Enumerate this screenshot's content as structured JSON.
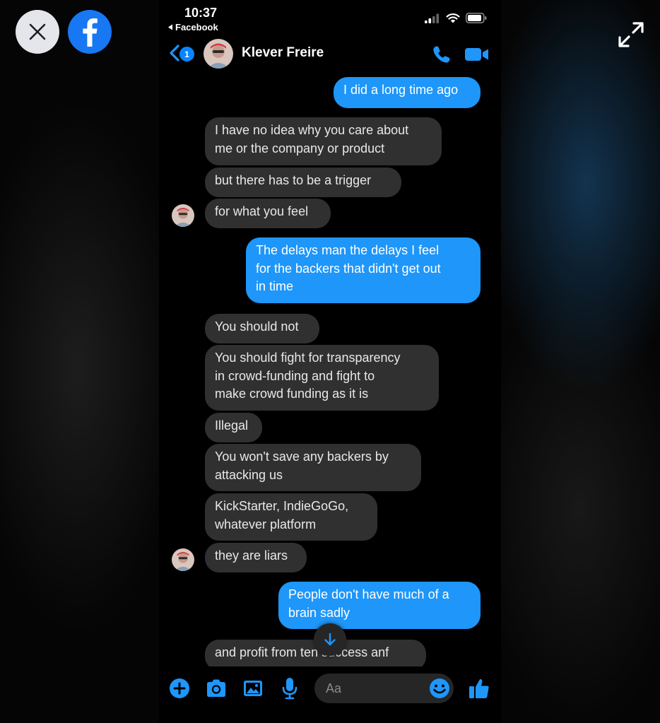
{
  "viewer": {
    "close_icon": "close-icon",
    "facebook_icon": "facebook-icon",
    "expand_icon": "expand-icon"
  },
  "status_bar": {
    "time": "10:37",
    "back_app": "Facebook",
    "icons": [
      "signal-icon",
      "wifi-icon",
      "battery-icon"
    ]
  },
  "header": {
    "unread_count": "1",
    "contact_name": "Klever Freire",
    "actions": [
      "phone-call-icon",
      "video-call-icon"
    ]
  },
  "messages": [
    {
      "from": "me",
      "text": "I did a long time ago"
    },
    {
      "from": "them",
      "text": "I have no idea why you care about\nme or the company or product"
    },
    {
      "from": "them",
      "text": "but there has to be a trigger"
    },
    {
      "from": "them",
      "text": "for what you feel"
    },
    {
      "from": "me",
      "text": "The delays man the delays I feel\nfor the backers that didn't get out\nin time"
    },
    {
      "from": "them",
      "text": "You should not"
    },
    {
      "from": "them",
      "text": "You should fight for transparency\nin crowd-funding and fight to\nmake crowd funding as it is"
    },
    {
      "from": "them",
      "text": "Illegal"
    },
    {
      "from": "them",
      "text": "You won't save any backers by\nattacking us"
    },
    {
      "from": "them",
      "text": "KickStarter, IndieGoGo,\nwhatever platform"
    },
    {
      "from": "them",
      "text": "they are liars"
    },
    {
      "from": "me",
      "text": "People don't have much of a\nbrain sadly"
    },
    {
      "from": "them",
      "text": "and profit from ten success anf"
    }
  ],
  "composer": {
    "placeholder": "Aa",
    "icons": [
      "plus-icon",
      "camera-icon",
      "gallery-icon",
      "microphone-icon",
      "emoji-icon",
      "thumbs-up-icon"
    ]
  },
  "colors": {
    "accent": "#1e96fa",
    "incoming_bubble": "#303030",
    "facebook_blue": "#1877f2"
  }
}
